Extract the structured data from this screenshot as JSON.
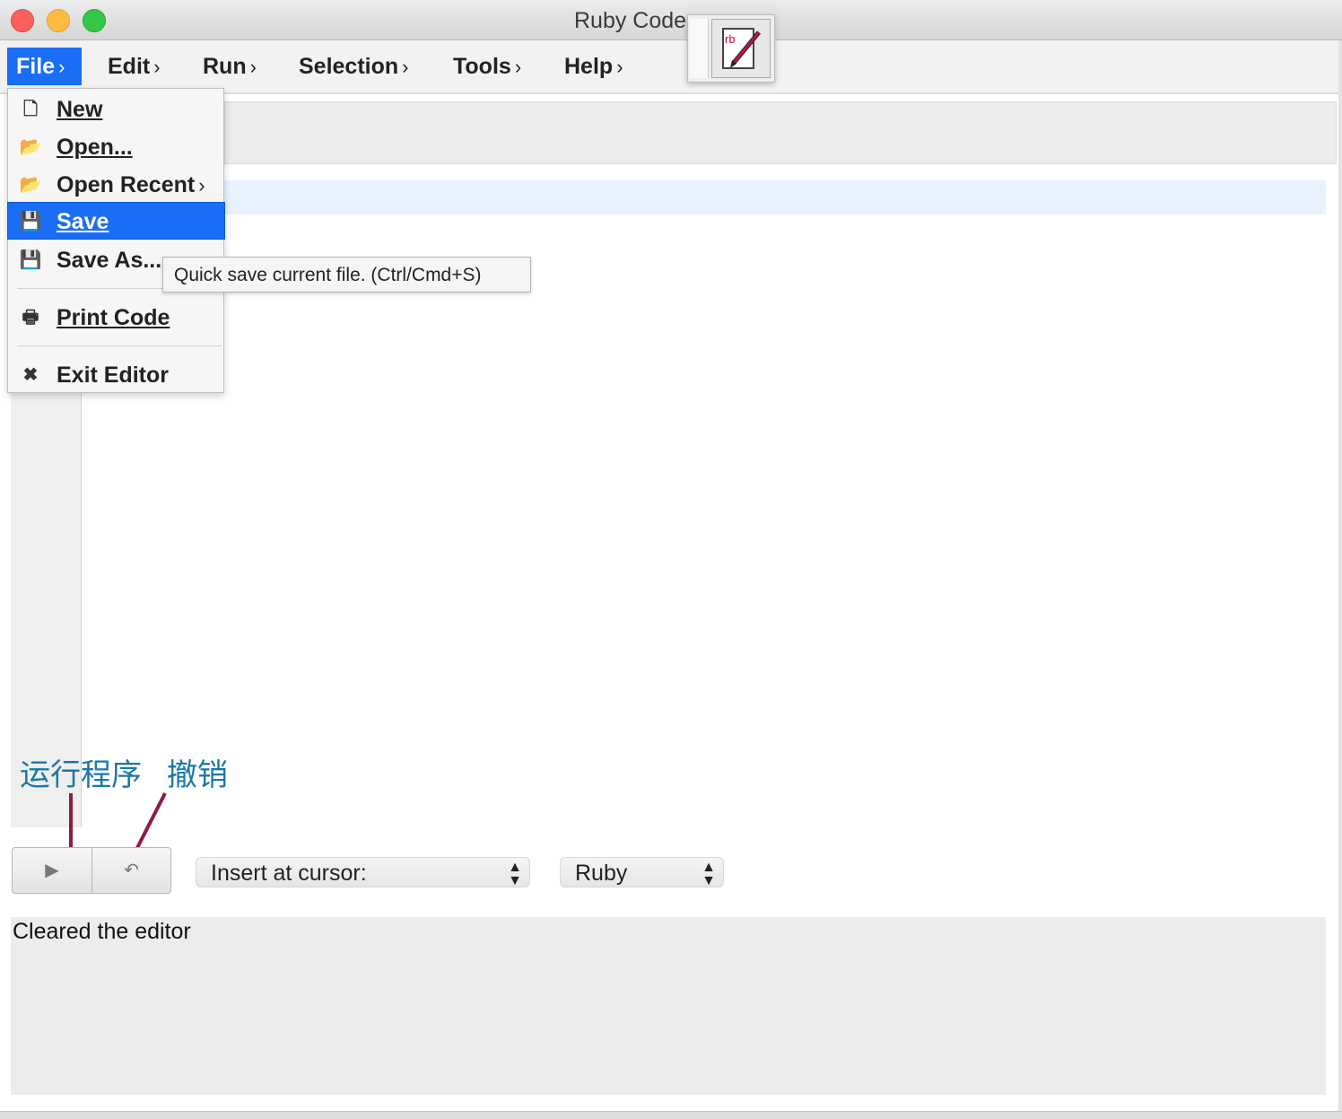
{
  "window": {
    "title": "Ruby Code Edit"
  },
  "menubar": {
    "items": [
      {
        "label": "File",
        "chevron": "›",
        "active": true
      },
      {
        "label": "Edit",
        "chevron": "›"
      },
      {
        "label": "Run",
        "chevron": "›"
      },
      {
        "label": "Selection",
        "chevron": "›"
      },
      {
        "label": "Tools",
        "chevron": "›"
      },
      {
        "label": "Help",
        "chevron": "›"
      }
    ]
  },
  "file_menu": {
    "items": [
      {
        "label": "New",
        "icon": "new-file-icon",
        "glyph": "🗋"
      },
      {
        "label": "Open...",
        "icon": "folder-open-icon",
        "glyph": "📂"
      },
      {
        "label": "Open Recent",
        "icon": "folder-open-icon",
        "glyph": "📂",
        "chevron": "›"
      },
      {
        "label": "Save",
        "icon": "save-icon",
        "glyph": "💾",
        "selected": true
      },
      {
        "label": "Save As...",
        "icon": "save-as-icon",
        "glyph": "💾"
      },
      {
        "label": "Print Code",
        "icon": "print-icon",
        "glyph": "🖶"
      },
      {
        "label": "Exit Editor",
        "icon": "close-icon",
        "glyph": "✖"
      }
    ]
  },
  "tooltip": {
    "text": "Quick save current file. (Ctrl/Cmd+S)"
  },
  "annotations": {
    "run": "运行程序",
    "undo": "撤销"
  },
  "controls": {
    "run_glyph": "▶",
    "undo_glyph": "↶",
    "insert_select": "Insert at cursor:",
    "language_select": "Ruby",
    "select_arrows": "▲▼"
  },
  "console": {
    "text": "Cleared the editor"
  },
  "colors": {
    "accent": "#1a6ef5",
    "annotation_text": "#1b78a6",
    "annotation_line": "#8b1c48"
  }
}
